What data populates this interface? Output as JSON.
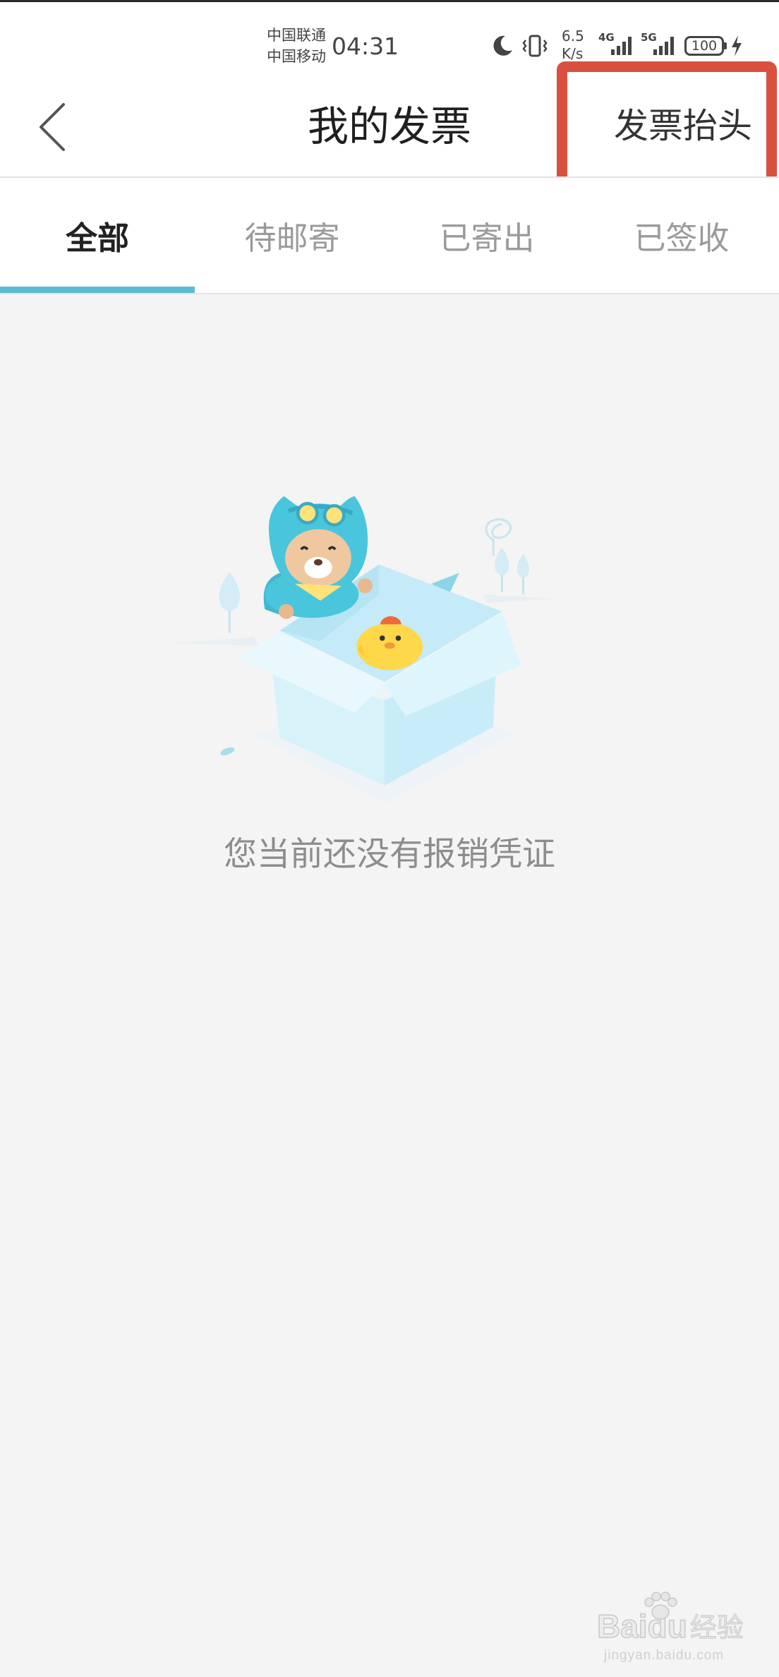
{
  "status_bar": {
    "carrier_1": "中国联通",
    "carrier_2": "中国移动",
    "time": "04:31",
    "net_speed_value": "6.5",
    "net_speed_unit": "K/s",
    "signal_1_type": "4G",
    "signal_2_type": "5G",
    "battery": "100",
    "icons": [
      "moon-icon",
      "vibrate-icon",
      "signal-4g-icon",
      "signal-5g-icon",
      "battery-icon",
      "charging-icon"
    ]
  },
  "header": {
    "back_icon": "chevron-left-icon",
    "title": "我的发票",
    "right_action": "发票抬头"
  },
  "tabs": [
    {
      "label": "全部",
      "active": true
    },
    {
      "label": "待邮寄",
      "active": false
    },
    {
      "label": "已寄出",
      "active": false
    },
    {
      "label": "已签收",
      "active": false
    }
  ],
  "empty_state": {
    "illustration": "open-box-with-mascot",
    "message": "您当前还没有报销凭证"
  },
  "watermark": {
    "brand_left": "Bai",
    "brand_right": "du",
    "brand_cn": "经验",
    "url": "jingyan.baidu.com"
  },
  "colors": {
    "accent": "#5bbcd4",
    "highlight_box": "#d9503e",
    "page_background": "#f4f4f4",
    "header_background": "#ffffff"
  }
}
